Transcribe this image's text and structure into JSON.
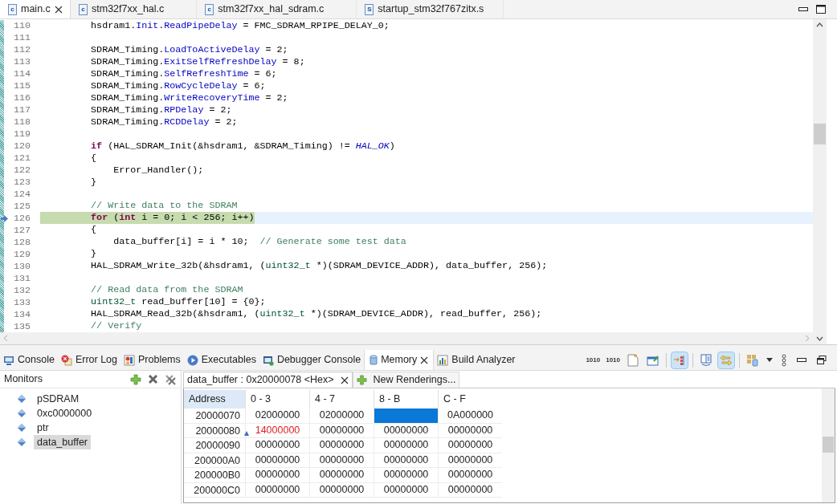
{
  "editor_tabs": [
    {
      "label": "main.c",
      "icon_letter": "c",
      "selected": true,
      "closable": true
    },
    {
      "label": "stm32f7xx_hal.c",
      "icon_letter": "c",
      "selected": false,
      "closable": false
    },
    {
      "label": "stm32f7xx_hal_sdram.c",
      "icon_letter": "c",
      "selected": false,
      "closable": false
    },
    {
      "label": "startup_stm32f767zitx.s",
      "icon_letter": "S",
      "selected": false,
      "closable": false
    }
  ],
  "code_lines": [
    {
      "number": "110",
      "current": false,
      "segments": [
        {
          "kind": "plain",
          "text": "        hsdram1."
        },
        {
          "kind": "field",
          "text": "Init"
        },
        {
          "kind": "plain",
          "text": "."
        },
        {
          "kind": "field",
          "text": "ReadPipeDelay"
        },
        {
          "kind": "plain",
          "text": " = FMC_SDRAM_RPIPE_DELAY_0;"
        }
      ]
    },
    {
      "number": "111",
      "current": false
    },
    {
      "number": "112",
      "current": false,
      "segments": [
        {
          "kind": "plain",
          "text": "        SDRAM_Timing."
        },
        {
          "kind": "field",
          "text": "LoadToActiveDelay"
        },
        {
          "kind": "plain",
          "text": " = 2;"
        }
      ]
    },
    {
      "number": "113",
      "current": false,
      "segments": [
        {
          "kind": "plain",
          "text": "        SDRAM_Timing."
        },
        {
          "kind": "field",
          "text": "ExitSelfRefreshDelay"
        },
        {
          "kind": "plain",
          "text": " = 8;"
        }
      ]
    },
    {
      "number": "114",
      "current": false,
      "segments": [
        {
          "kind": "plain",
          "text": "        SDRAM_Timing."
        },
        {
          "kind": "field",
          "text": "SelfRefreshTime"
        },
        {
          "kind": "plain",
          "text": " = 6;"
        }
      ]
    },
    {
      "number": "115",
      "current": false,
      "segments": [
        {
          "kind": "plain",
          "text": "        SDRAM_Timing."
        },
        {
          "kind": "field",
          "text": "RowCycleDelay"
        },
        {
          "kind": "plain",
          "text": " = 6;"
        }
      ]
    },
    {
      "number": "116",
      "current": false,
      "segments": [
        {
          "kind": "plain",
          "text": "        SDRAM_Timing."
        },
        {
          "kind": "field",
          "text": "WriteRecoveryTime"
        },
        {
          "kind": "plain",
          "text": " = 2;"
        }
      ]
    },
    {
      "number": "117",
      "current": false,
      "segments": [
        {
          "kind": "plain",
          "text": "        SDRAM_Timing."
        },
        {
          "kind": "field",
          "text": "RPDelay"
        },
        {
          "kind": "plain",
          "text": " = 2;"
        }
      ]
    },
    {
      "number": "118",
      "current": false,
      "segments": [
        {
          "kind": "plain",
          "text": "        SDRAM_Timing."
        },
        {
          "kind": "field",
          "text": "RCDDelay"
        },
        {
          "kind": "plain",
          "text": " = 2;"
        }
      ]
    },
    {
      "number": "119",
      "current": false
    },
    {
      "number": "120",
      "current": false,
      "segments": [
        {
          "kind": "keyword",
          "text": "        if"
        },
        {
          "kind": "plain",
          "text": " (HAL_SDRAM_Init(&hsdram1, &SDRAM_Timing) != "
        },
        {
          "kind": "constant",
          "text": "HAL_OK"
        },
        {
          "kind": "plain",
          "text": ")"
        }
      ]
    },
    {
      "number": "121",
      "current": false,
      "segments": [
        {
          "kind": "plain",
          "text": "        {"
        }
      ]
    },
    {
      "number": "122",
      "current": false,
      "segments": [
        {
          "kind": "plain",
          "text": "            Error_Handler();"
        }
      ]
    },
    {
      "number": "123",
      "current": false,
      "segments": [
        {
          "kind": "plain",
          "text": "        }"
        }
      ]
    },
    {
      "number": "124",
      "current": false
    },
    {
      "number": "125",
      "current": false,
      "segments": [
        {
          "kind": "comment",
          "text": "        // Write data to the SDRAM"
        }
      ]
    },
    {
      "number": "126",
      "current": true,
      "segments": [
        {
          "kind": "keyword",
          "text": "        for"
        },
        {
          "kind": "plain",
          "text": " ("
        },
        {
          "kind": "keyword",
          "text": "int"
        },
        {
          "kind": "plain",
          "text": " i = 0; i < 256; i++)"
        }
      ]
    },
    {
      "number": "127",
      "current": false,
      "segments": [
        {
          "kind": "plain",
          "text": "        {"
        }
      ]
    },
    {
      "number": "128",
      "current": false,
      "segments": [
        {
          "kind": "plain",
          "text": "            data_buffer[i] = i * 10;  "
        },
        {
          "kind": "comment",
          "text": "// Generate some test data"
        }
      ]
    },
    {
      "number": "129",
      "current": false,
      "segments": [
        {
          "kind": "plain",
          "text": "        }"
        }
      ]
    },
    {
      "number": "130",
      "current": false,
      "segments": [
        {
          "kind": "plain",
          "text": "        HAL_SDRAM_Write_32b(&hsdram1, ("
        },
        {
          "kind": "type",
          "text": "uint32_t"
        },
        {
          "kind": "plain",
          "text": " *)(SDRAM_DEVICE_ADDR), data_buffer, 256);"
        }
      ]
    },
    {
      "number": "131",
      "current": false
    },
    {
      "number": "132",
      "current": false,
      "segments": [
        {
          "kind": "comment",
          "text": "        // Read data from the SDRAM"
        }
      ]
    },
    {
      "number": "133",
      "current": false,
      "segments": [
        {
          "kind": "type",
          "text": "        uint32_t"
        },
        {
          "kind": "plain",
          "text": " read_buffer[10] = {0};"
        }
      ]
    },
    {
      "number": "134",
      "current": false,
      "segments": [
        {
          "kind": "plain",
          "text": "        HAL_SDRAM_Read_32b(&hsdram1, ("
        },
        {
          "kind": "type",
          "text": "uint32_t"
        },
        {
          "kind": "plain",
          "text": " *)(SDRAM_DEVICE_ADDR), read_buffer, 256);"
        }
      ]
    },
    {
      "number": "135",
      "current": false,
      "segments": [
        {
          "kind": "comment",
          "text": "        // Verify"
        }
      ]
    }
  ],
  "view_tabs": [
    {
      "kind": "console",
      "label": "Console",
      "selected": false
    },
    {
      "kind": "errorlog",
      "label": "Error Log",
      "selected": false
    },
    {
      "kind": "problems",
      "label": "Problems",
      "selected": false
    },
    {
      "kind": "executables",
      "label": "Executables",
      "selected": false
    },
    {
      "kind": "debugger",
      "label": "Debugger Console",
      "selected": false
    },
    {
      "kind": "memory",
      "label": "Memory",
      "selected": true
    },
    {
      "kind": "build",
      "label": "Build Analyzer",
      "selected": false
    }
  ],
  "toolbar": [
    {
      "kind": "binary-up",
      "text": "1010",
      "on": false
    },
    {
      "kind": "binary-down",
      "text": "1010",
      "on": false
    },
    {
      "kind": "new",
      "on": false
    },
    {
      "kind": "pin",
      "on": false
    },
    {
      "kind": "separator"
    },
    {
      "kind": "link",
      "on": true
    },
    {
      "kind": "separator"
    },
    {
      "kind": "pane",
      "on": false
    },
    {
      "kind": "swap",
      "on": true
    },
    {
      "kind": "separator"
    },
    {
      "kind": "layout",
      "on": false
    },
    {
      "kind": "caret",
      "on": false
    },
    {
      "kind": "chain",
      "on": false
    },
    {
      "kind": "minimize",
      "on": false
    },
    {
      "kind": "restore",
      "on": false
    }
  ],
  "monitors": {
    "title": "Monitors",
    "items": [
      {
        "label": "pSDRAM",
        "selected": false
      },
      {
        "label": "0xc0000000",
        "selected": false
      },
      {
        "label": "ptr",
        "selected": false
      },
      {
        "label": "data_buffer",
        "selected": true
      }
    ]
  },
  "rendering_tabs": [
    {
      "kind": "rendering",
      "label": "data_buffer : 0x20000078 <Hex>",
      "selected": true
    },
    {
      "kind": "add",
      "label": "New Renderings...",
      "selected": false
    }
  ],
  "memory_table": {
    "columns": [
      "Address",
      "0 - 3",
      "4 - 7",
      "8 - B",
      "C - F"
    ],
    "rows": [
      {
        "cells": [
          {
            "kind": "address",
            "value": "20000070",
            "changed": false,
            "selected": false
          },
          {
            "kind": "data",
            "value": "02000000",
            "changed": false,
            "selected": false
          },
          {
            "kind": "data",
            "value": "02000000",
            "changed": false,
            "selected": false
          },
          {
            "kind": "data",
            "changed": false,
            "selected": true
          },
          {
            "kind": "data",
            "value": "0A000000",
            "changed": false,
            "selected": false
          }
        ]
      },
      {
        "cells": [
          {
            "kind": "address",
            "value": "20000080",
            "changed": false,
            "selected": false
          },
          {
            "kind": "data",
            "value": "14000000",
            "changed": true,
            "selected": false
          },
          {
            "kind": "data",
            "value": "00000000",
            "changed": false,
            "selected": false
          },
          {
            "kind": "data",
            "value": "00000000",
            "changed": false,
            "selected": false
          },
          {
            "kind": "data",
            "value": "00000000",
            "changed": false,
            "selected": false
          }
        ]
      },
      {
        "cells": [
          {
            "kind": "address",
            "value": "20000090",
            "changed": false,
            "selected": false
          },
          {
            "kind": "data",
            "value": "00000000",
            "changed": false,
            "selected": false
          },
          {
            "kind": "data",
            "value": "00000000",
            "changed": false,
            "selected": false
          },
          {
            "kind": "data",
            "value": "00000000",
            "changed": false,
            "selected": false
          },
          {
            "kind": "data",
            "value": "00000000",
            "changed": false,
            "selected": false
          }
        ]
      },
      {
        "cells": [
          {
            "kind": "address",
            "value": "200000A0",
            "changed": false,
            "selected": false
          },
          {
            "kind": "data",
            "value": "00000000",
            "changed": false,
            "selected": false
          },
          {
            "kind": "data",
            "value": "00000000",
            "changed": false,
            "selected": false
          },
          {
            "kind": "data",
            "value": "00000000",
            "changed": false,
            "selected": false
          },
          {
            "kind": "data",
            "value": "00000000",
            "changed": false,
            "selected": false
          }
        ]
      },
      {
        "cells": [
          {
            "kind": "address",
            "value": "200000B0",
            "changed": false,
            "selected": false
          },
          {
            "kind": "data",
            "value": "00000000",
            "changed": false,
            "selected": false
          },
          {
            "kind": "data",
            "value": "00000000",
            "changed": false,
            "selected": false
          },
          {
            "kind": "data",
            "value": "00000000",
            "changed": false,
            "selected": false
          },
          {
            "kind": "data",
            "value": "00000000",
            "changed": false,
            "selected": false
          }
        ]
      },
      {
        "cells": [
          {
            "kind": "address",
            "value": "200000C0",
            "changed": false,
            "selected": false
          },
          {
            "kind": "data",
            "value": "00000000",
            "changed": false,
            "selected": false
          },
          {
            "kind": "data",
            "value": "00000000",
            "changed": false,
            "selected": false
          },
          {
            "kind": "data",
            "value": "00000000",
            "changed": false,
            "selected": false
          },
          {
            "kind": "data",
            "value": "00000000",
            "changed": false,
            "selected": false
          }
        ]
      }
    ]
  }
}
